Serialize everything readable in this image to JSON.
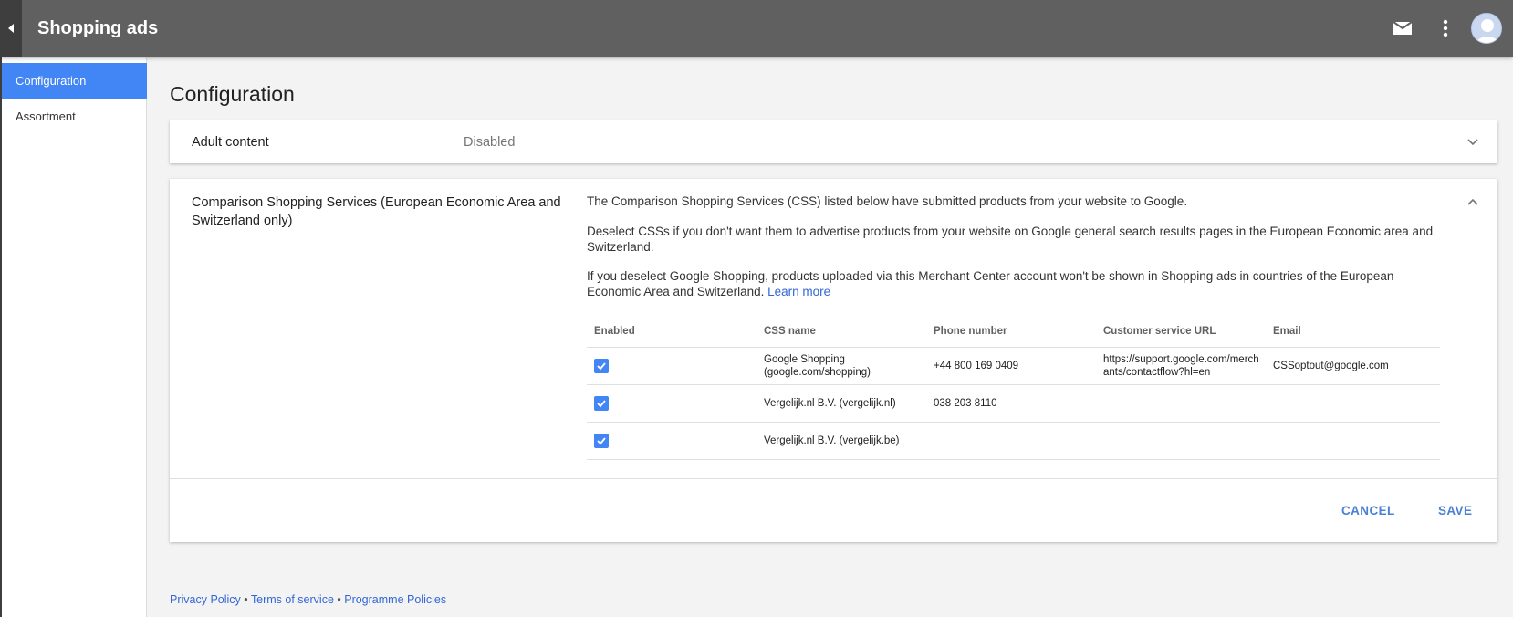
{
  "header": {
    "title": "Shopping ads",
    "icons": [
      "back-arrow-icon",
      "mail-icon",
      "more-vert-icon",
      "avatar"
    ]
  },
  "sidebar": {
    "items": [
      {
        "label": "Configuration",
        "active": true
      },
      {
        "label": "Assortment",
        "active": false
      }
    ]
  },
  "main": {
    "title": "Configuration",
    "adult_content": {
      "label": "Adult content",
      "value": "Disabled"
    },
    "css_section": {
      "label": "Comparison Shopping Services (European Economic Area and Switzerland only)",
      "para1": "The Comparison Shopping Services (CSS) listed below have submitted products from your website to Google.",
      "para2": "Deselect CSSs if you don't want them to advertise products from your website on Google general search results pages in the European Economic area and Switzerland.",
      "para3": "If you deselect Google Shopping, products uploaded via this Merchant Center account won't be shown in Shopping ads in countries of the European Economic Area and Switzerland.",
      "learn_more": "Learn more",
      "table": {
        "headers": [
          "Enabled",
          "CSS name",
          "Phone number",
          "Customer service URL",
          "Email"
        ],
        "rows": [
          {
            "enabled": true,
            "name": "Google Shopping (google.com/shopping)",
            "phone": "+44 800 169 0409",
            "url": "https://support.google.com/merchants/contactflow?hl=en",
            "email": "CSSoptout@google.com"
          },
          {
            "enabled": true,
            "name": "Vergelijk.nl B.V. (vergelijk.nl)",
            "phone": "038 203 8110",
            "url": "",
            "email": ""
          },
          {
            "enabled": true,
            "name": "Vergelijk.nl B.V. (vergelijk.be)",
            "phone": "",
            "url": "",
            "email": ""
          }
        ]
      },
      "cancel": "CANCEL",
      "save": "SAVE"
    }
  },
  "footer": {
    "privacy": "Privacy Policy",
    "sep1": " • ",
    "terms": "Terms of service",
    "sep2": " • ",
    "policies": "Programme Policies"
  },
  "colors": {
    "topbar": "#606060",
    "accent": "#4285f4",
    "link": "#3367d6"
  }
}
